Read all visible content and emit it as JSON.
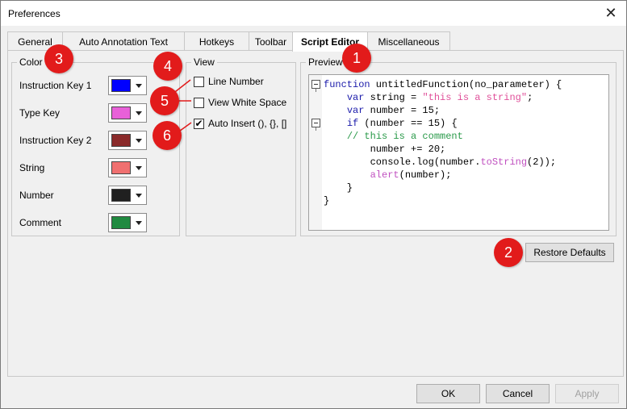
{
  "window": {
    "title": "Preferences",
    "close_glyph": "✕"
  },
  "tabs": [
    "General",
    "Auto Annotation Text",
    "Hotkeys",
    "Toolbar",
    "Script Editor",
    "Miscellaneous"
  ],
  "color_group": {
    "legend": "Color",
    "rows": [
      {
        "label": "Instruction Key 1",
        "color": "#0000ff"
      },
      {
        "label": "Type Key",
        "color": "#e860d8"
      },
      {
        "label": "Instruction Key 2",
        "color": "#8a2a2a"
      },
      {
        "label": "String",
        "color": "#f07070"
      },
      {
        "label": "Number",
        "color": "#202020"
      },
      {
        "label": "Comment",
        "color": "#208a40"
      }
    ]
  },
  "view_group": {
    "legend": "View",
    "options": [
      {
        "label": "Line Number",
        "checked": false
      },
      {
        "label": "View White Space",
        "checked": false
      },
      {
        "label": "Auto Insert (), {}, []",
        "checked": true
      }
    ]
  },
  "preview_group": {
    "legend": "Preview",
    "code_lines": [
      [
        [
          "kw",
          "function"
        ],
        [
          "plain",
          " untitledFunction(no_parameter) {"
        ]
      ],
      [
        [
          "plain",
          "    "
        ],
        [
          "kw",
          "var"
        ],
        [
          "plain",
          " string = "
        ],
        [
          "str",
          "\"this is a string\""
        ],
        [
          "plain",
          ";"
        ]
      ],
      [
        [
          "plain",
          "    "
        ],
        [
          "kw",
          "var"
        ],
        [
          "plain",
          " number = 15;"
        ]
      ],
      [
        [
          "plain",
          "    "
        ],
        [
          "kw",
          "if"
        ],
        [
          "plain",
          " (number == 15) {"
        ]
      ],
      [
        [
          "plain",
          "    "
        ],
        [
          "cmt",
          "// this is a comment"
        ]
      ],
      [
        [
          "plain",
          "        number += 20;"
        ]
      ],
      [
        [
          "plain",
          "        console.log(number."
        ],
        [
          "call",
          "toString"
        ],
        [
          "plain",
          "(2));"
        ]
      ],
      [
        [
          "plain",
          "        "
        ],
        [
          "call",
          "alert"
        ],
        [
          "plain",
          "(number);"
        ]
      ],
      [
        [
          "plain",
          "    }"
        ]
      ],
      [
        [
          "plain",
          "}"
        ]
      ]
    ]
  },
  "buttons": {
    "restore_defaults": "Restore Defaults",
    "ok": "OK",
    "cancel": "Cancel",
    "apply": "Apply"
  },
  "callouts": [
    "1",
    "2",
    "3",
    "4",
    "5",
    "6"
  ],
  "accent_color": "#e21b1b"
}
